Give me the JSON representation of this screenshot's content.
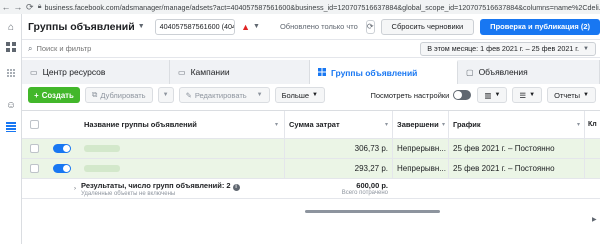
{
  "browser": {
    "url": "business.facebook.com/adsmanager/manage/adsets?act=404057587561600&business_id=120707516637884&global_scope_id=120707516637884&columns=name%2Cdeli..."
  },
  "header": {
    "title": "Группы объявлений",
    "account_select": "404057587561600 (40405758756...",
    "status": "Обновлено только что",
    "discard_label": "Сбросить черновики",
    "publish_label": "Проверка и публикация (2)"
  },
  "search": {
    "placeholder": "Поиск и фильтр",
    "date_range": "В этом месяце: 1 фев 2021 г. – 25 фев 2021 г."
  },
  "tabs": [
    {
      "label": "Центр ресурсов"
    },
    {
      "label": "Кампании"
    },
    {
      "label": "Группы объявлений"
    },
    {
      "label": "Объявления"
    }
  ],
  "toolbar": {
    "create_label": "Создать",
    "duplicate_label": "Дублировать",
    "edit_label": "Редактировать",
    "more_label": "Больше",
    "view_settings_label": "Посмотреть настройки",
    "reports_label": "Отчеты"
  },
  "table": {
    "headers": {
      "name": "Название группы объявлений",
      "spend": "Сумма затрат",
      "delivery": "Завершени",
      "schedule": "График",
      "extra": "Кл"
    },
    "rows": [
      {
        "spend": "306,73 р.",
        "delivery": "Непрерывн...",
        "schedule": "25 фев 2021 г. – Постоянно"
      },
      {
        "spend": "293,27 р.",
        "delivery": "Непрерывн...",
        "schedule": "25 фев 2021 г. – Постоянно"
      }
    ],
    "total": {
      "label": "Результаты, число групп объявлений: 2",
      "sub": "Удаленные объекты не включены",
      "spend": "600,00 р.",
      "spend_sub": "Всего потрачено"
    }
  }
}
